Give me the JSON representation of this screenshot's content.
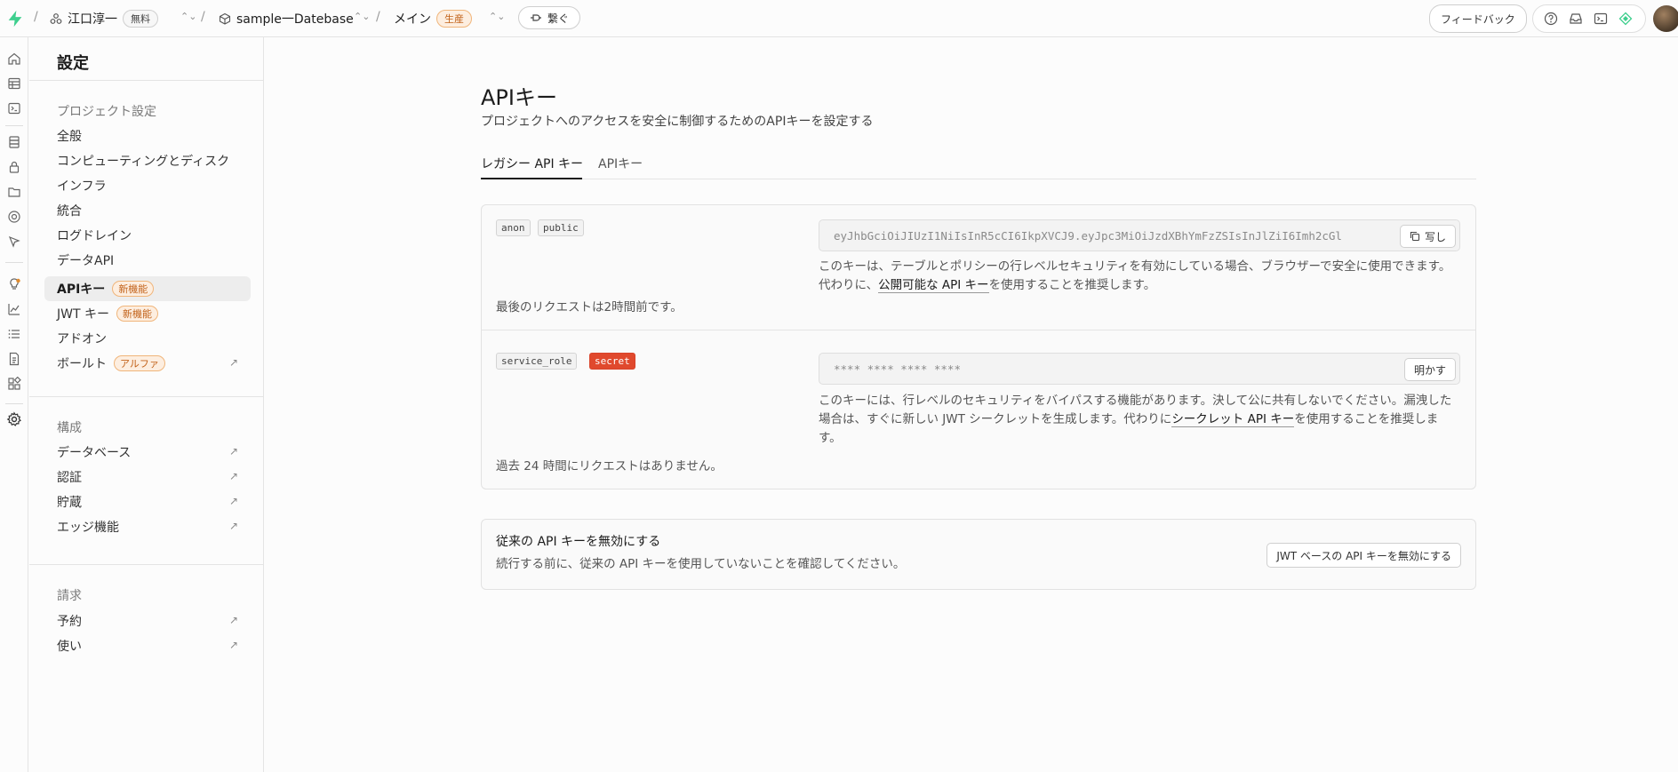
{
  "topbar": {
    "org_name": "江口淳一",
    "org_plan": "無料",
    "project_name": "sample一Datebase",
    "branch_name": "メイン",
    "branch_env": "生産",
    "connect_label": "繋ぐ",
    "feedback_label": "フィードバック"
  },
  "sidebar": {
    "title": "設定",
    "sections": {
      "project": "プロジェクト設定",
      "config": "構成",
      "billing": "請求"
    },
    "items": {
      "general": "全般",
      "compute": "コンピューティングとディスク",
      "infra": "インフラ",
      "integrations": "統合",
      "log_drains": "ログドレイン",
      "data_api": "データAPI",
      "api_keys": "APIキー",
      "api_keys_badge": "新機能",
      "jwt_keys": "JWT キー",
      "jwt_keys_badge": "新機能",
      "addons": "アドオン",
      "vault": "ボールト",
      "vault_badge": "アルファ",
      "database": "データベース",
      "auth": "認証",
      "storage": "貯蔵",
      "edge_functions": "エッジ機能",
      "subscription": "予約",
      "usage": "使い"
    }
  },
  "main": {
    "title": "APIキー",
    "subtitle": "プロジェクトへのアクセスを安全に制御するためのAPIキーを設定する",
    "tabs": {
      "legacy": "レガシー API キー",
      "api_keys": "APIキー"
    },
    "anon": {
      "tag1": "anon",
      "tag2": "public",
      "key": "eyJhbGciOiJIUzI1NiIsInR5cCI6IkpXVCJ9.eyJpc3MiOiJzdXBhYmFzZSIsInJlZiI6Imh2cGl",
      "copy_label": "写し",
      "desc_a": "このキーは、テーブルとポリシーの行レベルセキュリティを有効にしている場合、ブラウザーで安全に使用できます。代わりに、",
      "desc_link": "公開可能な API キー",
      "desc_b": "を使用することを推奨します。",
      "last_request": "最後のリクエストは2時間前です。"
    },
    "service": {
      "tag1": "service_role",
      "tag2": "secret",
      "key": "**** **** **** ****",
      "reveal_label": "明かす",
      "desc_a": "このキーには、行レベルのセキュリティをバイパスする機能があります。決して公に共有しないでください。漏洩した場合は、すぐに新しい JWT シークレットを生成します。代わりに",
      "desc_link": "シークレット API キー",
      "desc_b": "を使用することを推奨します。",
      "last_request": "過去 24 時間にリクエストはありません。"
    },
    "legacy_disable": {
      "title": "従来の API キーを無効にする",
      "subtitle": "続行する前に、従来の API キーを使用していないことを確認してください。",
      "button": "JWT ベースの API キーを無効にする"
    }
  }
}
